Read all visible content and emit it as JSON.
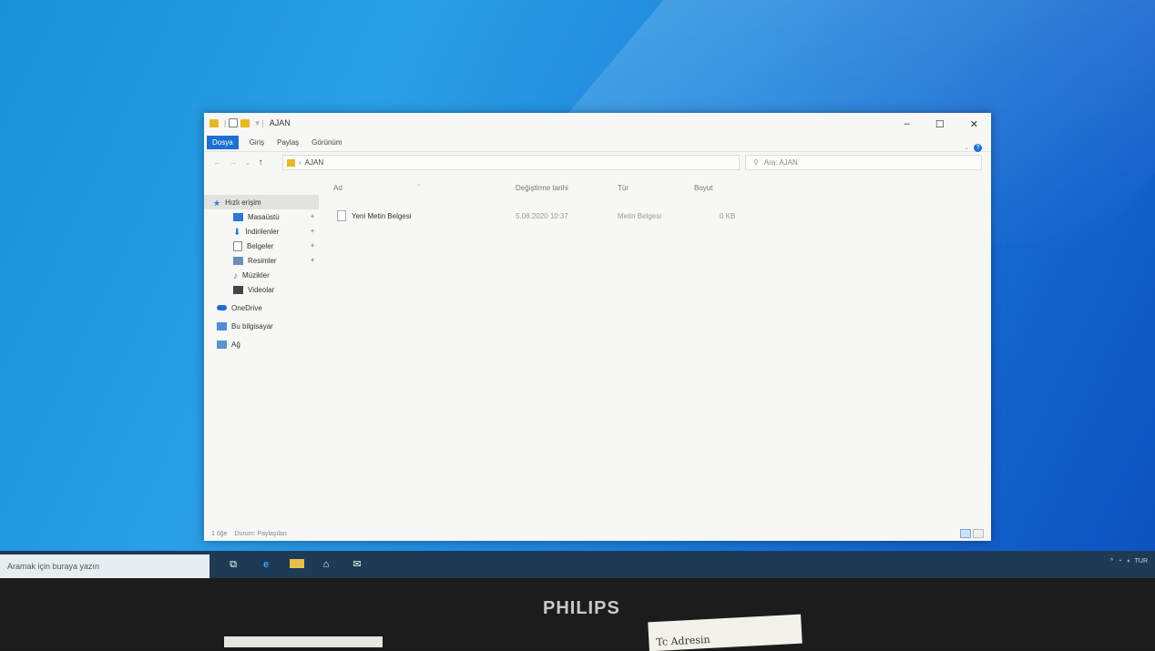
{
  "window": {
    "title": "AJAN",
    "ribbon_tabs": [
      "Dosya",
      "Giriş",
      "Paylaş",
      "Görünüm"
    ],
    "path": "AJAN",
    "search_placeholder": "Ara: AJAN"
  },
  "nav_pane": {
    "items": [
      {
        "label": "Hızlı erişim",
        "icon": "star-icon"
      },
      {
        "label": "Masaüstü",
        "icon": "desktop-icon",
        "pinned": true
      },
      {
        "label": "İndirilenler",
        "icon": "download-icon",
        "pinned": true
      },
      {
        "label": "Belgeler",
        "icon": "documents-icon",
        "pinned": true
      },
      {
        "label": "Resimler",
        "icon": "pictures-icon",
        "pinned": true
      },
      {
        "label": "Müzikler",
        "icon": "music-icon"
      },
      {
        "label": "Videolar",
        "icon": "videos-icon"
      },
      {
        "label": "OneDrive",
        "icon": "cloud-icon"
      },
      {
        "label": "Bu bilgisayar",
        "icon": "computer-icon"
      },
      {
        "label": "Ağ",
        "icon": "network-icon"
      }
    ]
  },
  "columns": [
    "Ad",
    "Değiştirme tarihi",
    "Tür",
    "Boyut"
  ],
  "files": [
    {
      "name": "Yeni Metin Belgesi",
      "modified": "5.08.2020 10:37",
      "type": "Metin Belgesi",
      "size": "0 KB"
    }
  ],
  "status_bar": {
    "count": "1 öğe",
    "state": "Durum: Paylaşılan"
  },
  "taskbar": {
    "search_placeholder": "Aramak için buraya yazın",
    "tray_lang": "TUR"
  },
  "monitor": {
    "brand": "PHILIPS",
    "note": "Tc Adresin"
  }
}
